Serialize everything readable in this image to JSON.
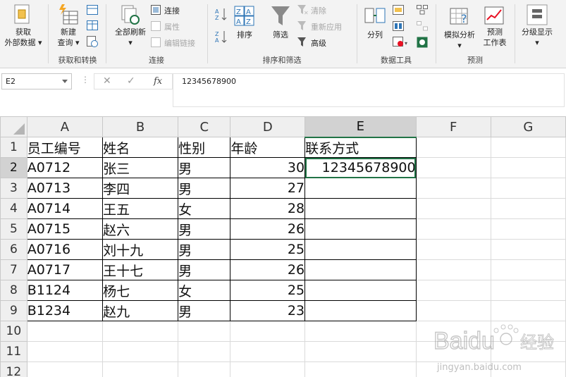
{
  "ribbon": {
    "get_external": [
      "获取",
      "外部数据"
    ],
    "new_query": [
      "新建",
      "查询"
    ],
    "refresh_all": "全部刷新",
    "connections": "连接",
    "properties": "属性",
    "edit_links": "编辑链接",
    "sort": "排序",
    "filter": "筛选",
    "clear": "清除",
    "reapply": "重新应用",
    "advanced": "高级",
    "text_to_columns": "分列",
    "what_if": "模拟分析",
    "forecast_sheet": [
      "预测",
      "工作表"
    ],
    "outline": "分级显示",
    "groups": [
      "获取和转换",
      "连接",
      "排序和筛选",
      "数据工具",
      "预测"
    ]
  },
  "formula_bar": {
    "name_box": "E2",
    "dots": "⋮",
    "cancel": "✕",
    "enter": "✓",
    "fx": "fx",
    "content": "12345678900"
  },
  "sheet": {
    "columns": [
      "A",
      "B",
      "C",
      "D",
      "E",
      "F",
      "G"
    ],
    "row_numbers": [
      "1",
      "2",
      "3",
      "4",
      "5",
      "6",
      "7",
      "8",
      "9",
      "10",
      "11",
      "12"
    ],
    "header": [
      "员工编号",
      "姓名",
      "性别",
      "年龄",
      "联系方式"
    ],
    "rows": [
      [
        "A0712",
        "张三",
        "男",
        "30",
        "12345678900"
      ],
      [
        "A0713",
        "李四",
        "男",
        "27",
        ""
      ],
      [
        "A0714",
        "王五",
        "女",
        "28",
        ""
      ],
      [
        "A0715",
        "赵六",
        "男",
        "26",
        ""
      ],
      [
        "A0716",
        "刘十九",
        "男",
        "25",
        ""
      ],
      [
        "A0717",
        "王十七",
        "男",
        "26",
        ""
      ],
      [
        "B1124",
        "杨七",
        "女",
        "25",
        ""
      ],
      [
        "B1234",
        "赵九",
        "男",
        "23",
        ""
      ]
    ],
    "active_cell": "E2"
  },
  "watermark": {
    "brand": "Baidu",
    "suffix": "经验",
    "url": "jingyan.baidu.com"
  },
  "colors": {
    "excel_green": "#217346",
    "ribbon_bg": "#f3f3f3"
  }
}
